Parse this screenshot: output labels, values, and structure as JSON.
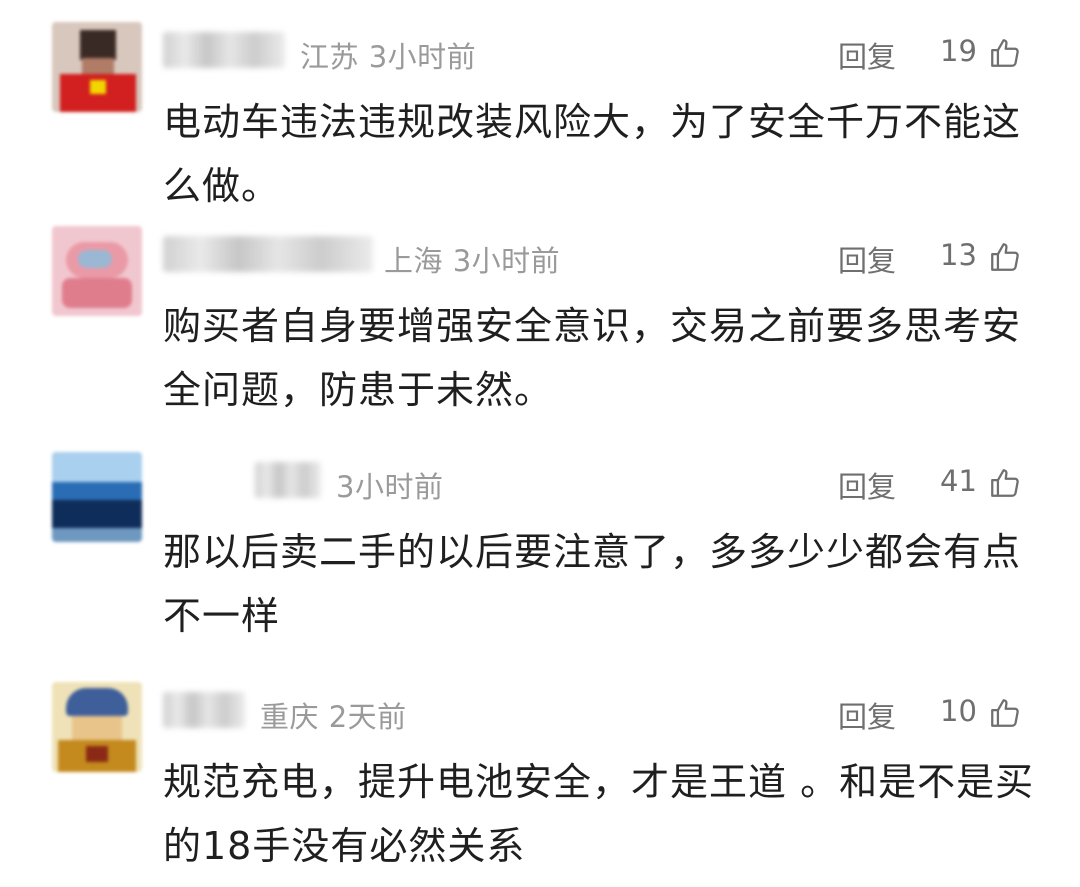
{
  "comments": [
    {
      "location": "江苏",
      "time": "3小时前",
      "reply_label": "回复",
      "likes": "19",
      "body": "电动车违法违规改装风险大，为了安全千万不能这么做。"
    },
    {
      "location": "上海",
      "time": "3小时前",
      "reply_label": "回复",
      "likes": "13",
      "body": "购买者自身要增强安全意识，交易之前要多思考安全问题，防患于未然。"
    },
    {
      "location": "",
      "time": "3小时前",
      "reply_label": "回复",
      "likes": "41",
      "body": "那以后卖二手的以后要注意了，多多少少都会有点不一样"
    },
    {
      "location": "重庆",
      "time": "2天前",
      "reply_label": "回复",
      "likes": "10",
      "body": "规范充电，提升电池安全，才是王道 。和是不是买的18手没有必然关系"
    }
  ],
  "icons": {
    "like": "thumbs-up-icon",
    "avatar": "user-avatar"
  },
  "colors": {
    "meta": "#9a9a9a",
    "action": "#6f6f6f",
    "text": "#1f1f1f"
  }
}
